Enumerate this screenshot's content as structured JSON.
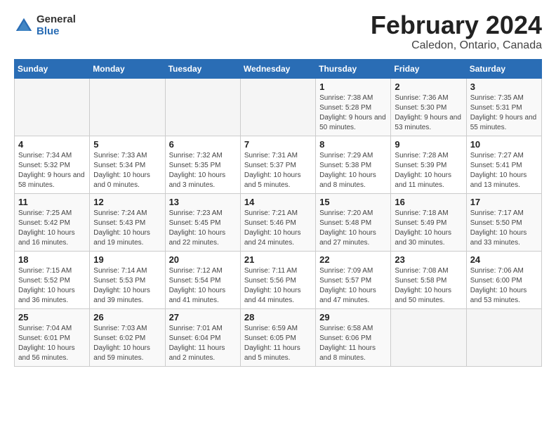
{
  "logo": {
    "general": "General",
    "blue": "Blue"
  },
  "title": "February 2024",
  "subtitle": "Caledon, Ontario, Canada",
  "days_of_week": [
    "Sunday",
    "Monday",
    "Tuesday",
    "Wednesday",
    "Thursday",
    "Friday",
    "Saturday"
  ],
  "weeks": [
    [
      {
        "day": "",
        "info": ""
      },
      {
        "day": "",
        "info": ""
      },
      {
        "day": "",
        "info": ""
      },
      {
        "day": "",
        "info": ""
      },
      {
        "day": "1",
        "info": "Sunrise: 7:38 AM\nSunset: 5:28 PM\nDaylight: 9 hours and 50 minutes."
      },
      {
        "day": "2",
        "info": "Sunrise: 7:36 AM\nSunset: 5:30 PM\nDaylight: 9 hours and 53 minutes."
      },
      {
        "day": "3",
        "info": "Sunrise: 7:35 AM\nSunset: 5:31 PM\nDaylight: 9 hours and 55 minutes."
      }
    ],
    [
      {
        "day": "4",
        "info": "Sunrise: 7:34 AM\nSunset: 5:32 PM\nDaylight: 9 hours and 58 minutes."
      },
      {
        "day": "5",
        "info": "Sunrise: 7:33 AM\nSunset: 5:34 PM\nDaylight: 10 hours and 0 minutes."
      },
      {
        "day": "6",
        "info": "Sunrise: 7:32 AM\nSunset: 5:35 PM\nDaylight: 10 hours and 3 minutes."
      },
      {
        "day": "7",
        "info": "Sunrise: 7:31 AM\nSunset: 5:37 PM\nDaylight: 10 hours and 5 minutes."
      },
      {
        "day": "8",
        "info": "Sunrise: 7:29 AM\nSunset: 5:38 PM\nDaylight: 10 hours and 8 minutes."
      },
      {
        "day": "9",
        "info": "Sunrise: 7:28 AM\nSunset: 5:39 PM\nDaylight: 10 hours and 11 minutes."
      },
      {
        "day": "10",
        "info": "Sunrise: 7:27 AM\nSunset: 5:41 PM\nDaylight: 10 hours and 13 minutes."
      }
    ],
    [
      {
        "day": "11",
        "info": "Sunrise: 7:25 AM\nSunset: 5:42 PM\nDaylight: 10 hours and 16 minutes."
      },
      {
        "day": "12",
        "info": "Sunrise: 7:24 AM\nSunset: 5:43 PM\nDaylight: 10 hours and 19 minutes."
      },
      {
        "day": "13",
        "info": "Sunrise: 7:23 AM\nSunset: 5:45 PM\nDaylight: 10 hours and 22 minutes."
      },
      {
        "day": "14",
        "info": "Sunrise: 7:21 AM\nSunset: 5:46 PM\nDaylight: 10 hours and 24 minutes."
      },
      {
        "day": "15",
        "info": "Sunrise: 7:20 AM\nSunset: 5:48 PM\nDaylight: 10 hours and 27 minutes."
      },
      {
        "day": "16",
        "info": "Sunrise: 7:18 AM\nSunset: 5:49 PM\nDaylight: 10 hours and 30 minutes."
      },
      {
        "day": "17",
        "info": "Sunrise: 7:17 AM\nSunset: 5:50 PM\nDaylight: 10 hours and 33 minutes."
      }
    ],
    [
      {
        "day": "18",
        "info": "Sunrise: 7:15 AM\nSunset: 5:52 PM\nDaylight: 10 hours and 36 minutes."
      },
      {
        "day": "19",
        "info": "Sunrise: 7:14 AM\nSunset: 5:53 PM\nDaylight: 10 hours and 39 minutes."
      },
      {
        "day": "20",
        "info": "Sunrise: 7:12 AM\nSunset: 5:54 PM\nDaylight: 10 hours and 41 minutes."
      },
      {
        "day": "21",
        "info": "Sunrise: 7:11 AM\nSunset: 5:56 PM\nDaylight: 10 hours and 44 minutes."
      },
      {
        "day": "22",
        "info": "Sunrise: 7:09 AM\nSunset: 5:57 PM\nDaylight: 10 hours and 47 minutes."
      },
      {
        "day": "23",
        "info": "Sunrise: 7:08 AM\nSunset: 5:58 PM\nDaylight: 10 hours and 50 minutes."
      },
      {
        "day": "24",
        "info": "Sunrise: 7:06 AM\nSunset: 6:00 PM\nDaylight: 10 hours and 53 minutes."
      }
    ],
    [
      {
        "day": "25",
        "info": "Sunrise: 7:04 AM\nSunset: 6:01 PM\nDaylight: 10 hours and 56 minutes."
      },
      {
        "day": "26",
        "info": "Sunrise: 7:03 AM\nSunset: 6:02 PM\nDaylight: 10 hours and 59 minutes."
      },
      {
        "day": "27",
        "info": "Sunrise: 7:01 AM\nSunset: 6:04 PM\nDaylight: 11 hours and 2 minutes."
      },
      {
        "day": "28",
        "info": "Sunrise: 6:59 AM\nSunset: 6:05 PM\nDaylight: 11 hours and 5 minutes."
      },
      {
        "day": "29",
        "info": "Sunrise: 6:58 AM\nSunset: 6:06 PM\nDaylight: 11 hours and 8 minutes."
      },
      {
        "day": "",
        "info": ""
      },
      {
        "day": "",
        "info": ""
      }
    ]
  ]
}
